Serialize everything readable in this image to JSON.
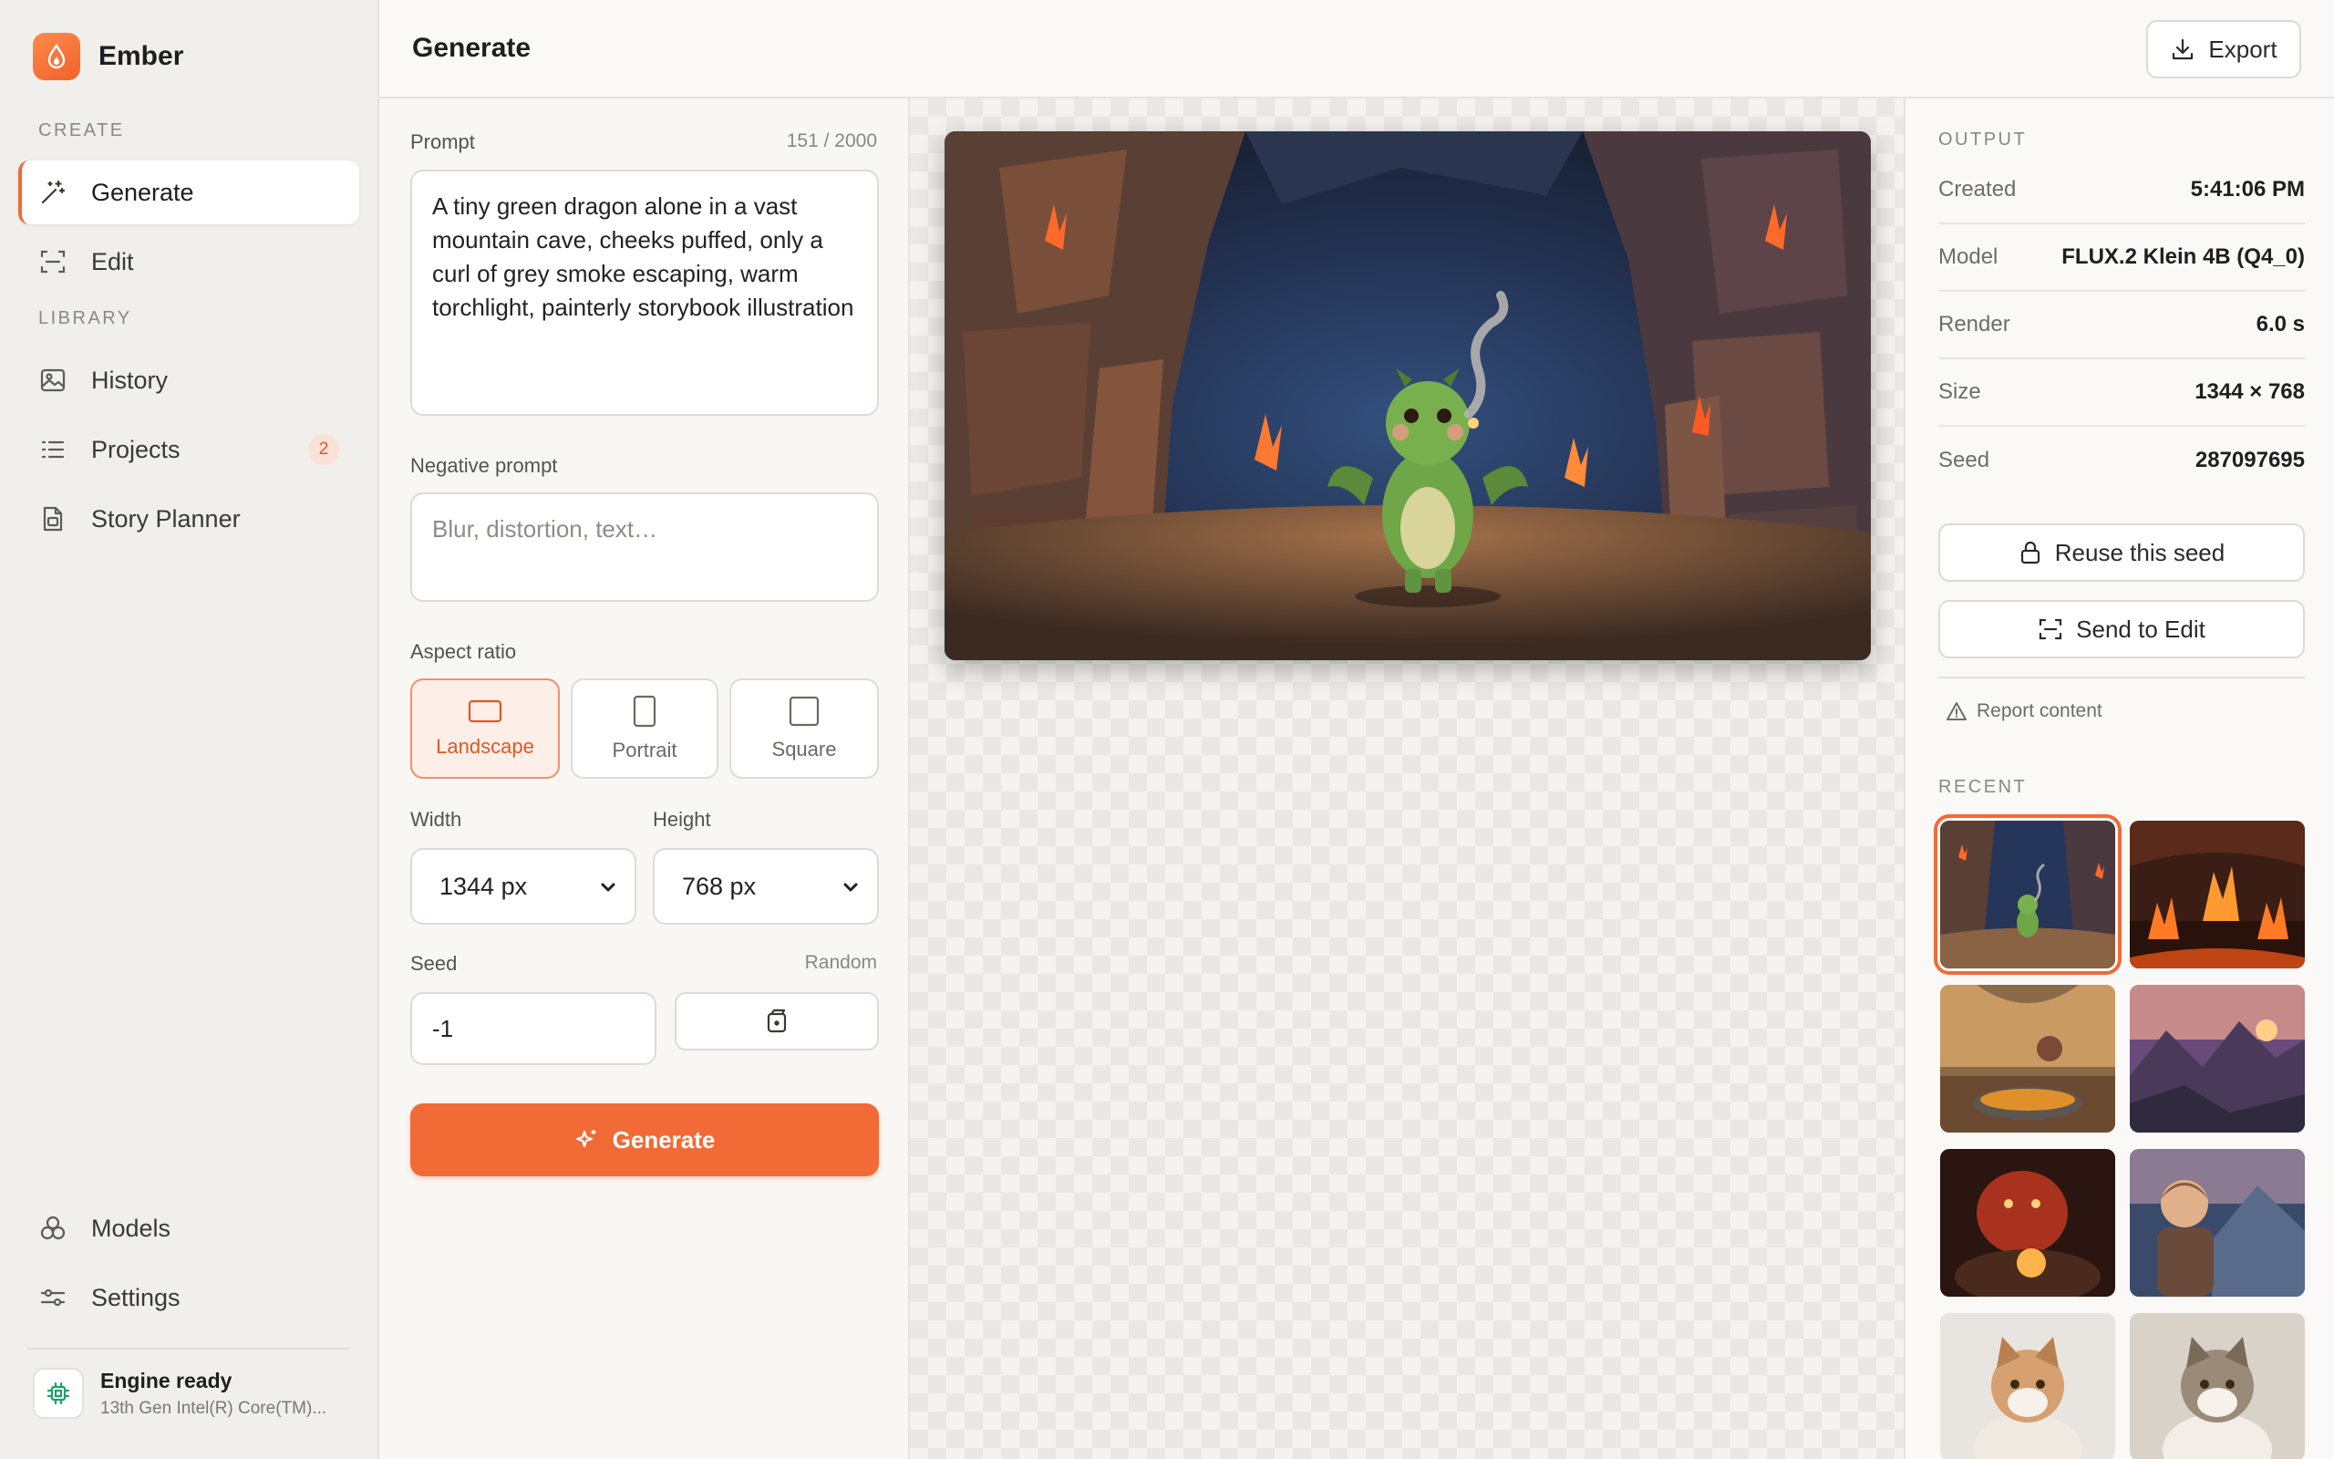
{
  "app": {
    "name": "Ember",
    "accent": "#f26a35"
  },
  "sidebar": {
    "create_label": "CREATE",
    "library_label": "LIBRARY",
    "items": [
      {
        "label": "Generate",
        "icon": "magic-wand-icon",
        "active": true
      },
      {
        "label": "Edit",
        "icon": "scan-frame-icon",
        "active": false
      },
      {
        "label": "History",
        "icon": "image-gallery-icon",
        "active": false
      },
      {
        "label": "Projects",
        "icon": "list-icon",
        "active": false,
        "badge": "2"
      },
      {
        "label": "Story Planner",
        "icon": "document-icon",
        "active": false
      },
      {
        "label": "Models",
        "icon": "models-icon",
        "active": false
      },
      {
        "label": "Settings",
        "icon": "sliders-icon",
        "active": false
      }
    ],
    "engine": {
      "title": "Engine ready",
      "subtitle": "13th Gen Intel(R) Core(TM)...",
      "status_color": "#22a06b"
    }
  },
  "header": {
    "title": "Generate",
    "export_label": "Export"
  },
  "form": {
    "prompt_label": "Prompt",
    "prompt_count": "151 / 2000",
    "prompt_value": "A tiny green dragon alone in a vast mountain cave, cheeks puffed, only a curl of grey smoke escaping, warm torchlight, painterly storybook illustration",
    "negative_label": "Negative prompt",
    "negative_placeholder": "Blur, distortion, text…",
    "aspect_label": "Aspect ratio",
    "aspect_options": [
      {
        "label": "Landscape",
        "selected": true
      },
      {
        "label": "Portrait",
        "selected": false
      },
      {
        "label": "Square",
        "selected": false
      }
    ],
    "width_label": "Width",
    "width_value": "1344 px",
    "height_label": "Height",
    "height_value": "768 px",
    "seed_label": "Seed",
    "seed_mode": "Random",
    "seed_value": "-1",
    "generate_label": "Generate"
  },
  "output": {
    "heading": "OUTPUT",
    "meta": [
      {
        "key": "Created",
        "value": "5:41:06 PM"
      },
      {
        "key": "Model",
        "value": "FLUX.2 Klein 4B (Q4_0)"
      },
      {
        "key": "Render",
        "value": "6.0 s"
      },
      {
        "key": "Size",
        "value": "1344 × 768"
      },
      {
        "key": "Seed",
        "value": "287097695"
      }
    ],
    "reuse_label": "Reuse this seed",
    "send_label": "Send to Edit",
    "report_label": "Report content",
    "recent_heading": "RECENT"
  }
}
